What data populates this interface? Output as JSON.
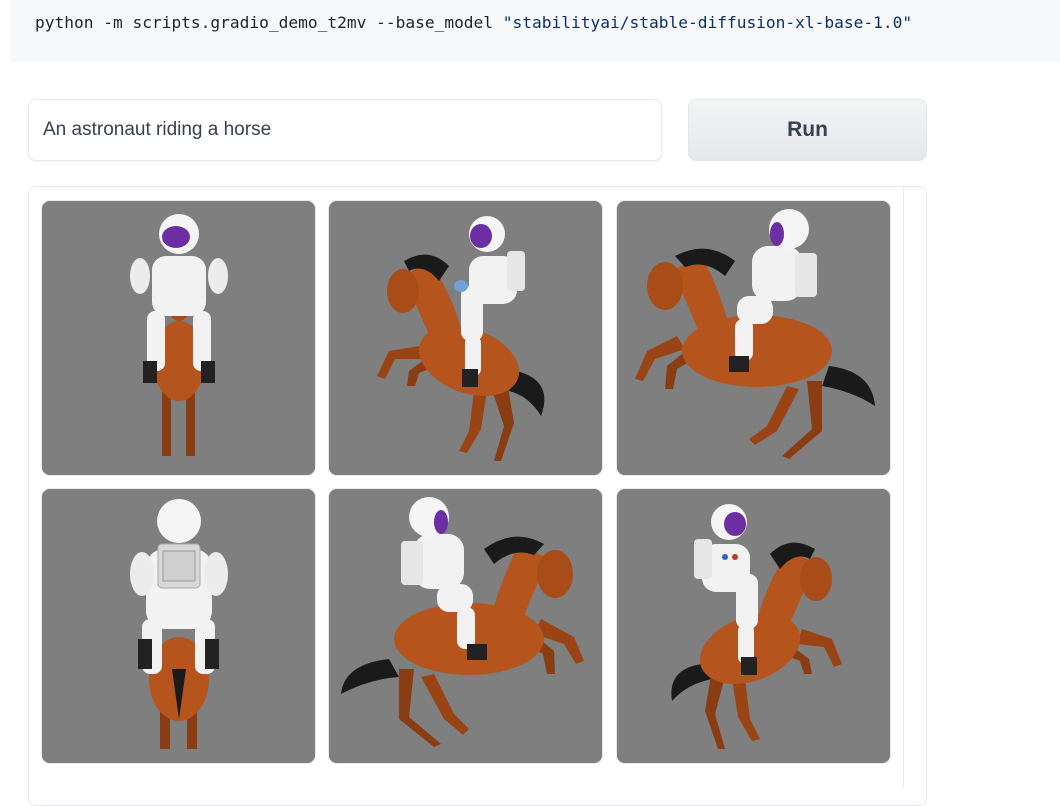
{
  "code": {
    "command": "python -m scripts.gradio_demo_t2mv --base_model ",
    "argument": "\"stabilityai/stable-diffusion-xl-base-1.0\""
  },
  "prompt": {
    "value": "An astronaut riding a horse"
  },
  "run_button": {
    "label": "Run"
  },
  "gallery": {
    "background_color": "#7f7f7f",
    "images": [
      {
        "view": "front",
        "subject": "astronaut riding horse"
      },
      {
        "view": "front-left",
        "subject": "astronaut riding horse"
      },
      {
        "view": "left",
        "subject": "astronaut riding horse"
      },
      {
        "view": "back",
        "subject": "astronaut riding horse"
      },
      {
        "view": "right",
        "subject": "astronaut riding horse"
      },
      {
        "view": "front-right",
        "subject": "astronaut riding horse"
      }
    ]
  },
  "colors": {
    "horse": "#b5541c",
    "suit": "#f2f2f2",
    "visor": "#6b2fa3",
    "hair": "#1a1a1a"
  }
}
